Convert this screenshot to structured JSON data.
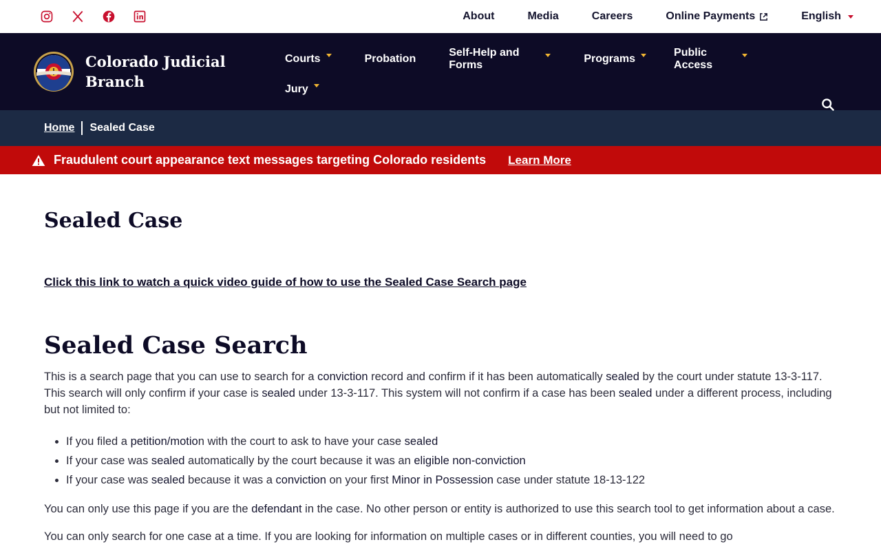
{
  "social": [
    {
      "name": "instagram-icon"
    },
    {
      "name": "x-icon"
    },
    {
      "name": "facebook-icon"
    },
    {
      "name": "linkedin-icon"
    }
  ],
  "utility_nav": {
    "about": "About",
    "media": "Media",
    "careers": "Careers",
    "online_payments": "Online Payments",
    "language": "English"
  },
  "brand": {
    "name": "Colorado Judicial Branch",
    "seal_top_text": "COLORADO",
    "seal_bottom_text": "COURTS"
  },
  "main_nav": {
    "courts": "Courts",
    "probation": "Probation",
    "self_help": "Self-Help and Forms",
    "programs": "Programs",
    "public_access": "Public Access",
    "jury": "Jury"
  },
  "breadcrumb": {
    "home": "Home",
    "current": "Sealed Case"
  },
  "alert": {
    "message": "Fraudulent court appearance text messages targeting Colorado residents",
    "link": "Learn More"
  },
  "content": {
    "title": "Sealed Case",
    "video_link": "Click this link to watch a quick video guide of how to use the Sealed Case Search page",
    "section_title": "Sealed Case Search",
    "p1": {
      "a": "This is a search page that you can use to search for a ",
      "b": "conviction",
      "c": " record and confirm if it has been automatically ",
      "d": "sealed",
      "e": " by the court under statute 13-3-117. This search will only confirm if your case is ",
      "f": "sealed",
      "g": " under 13-3-117. This system will not confirm if a case has been ",
      "h": "sealed",
      "i": " under a different process, including but not limited to:"
    },
    "bullets": [
      {
        "a": "If you filed a ",
        "b": "petition/motio",
        "c": "n with the court to ask to have your case ",
        "d": "sealed",
        "e": ""
      },
      {
        "a": "If your case was ",
        "b": "sealed",
        "c": " automatically by the court because it was an ",
        "d": "eligible non-conviction",
        "e": ""
      },
      {
        "a": "If your case was ",
        "b": "sealed",
        "c": " because it was a ",
        "d": "conviction",
        "e": " on your first ",
        "f": "Minor in Possession",
        "g": " case under statute 18-13-122"
      }
    ],
    "p2": {
      "a": "You can only use this page if you are the ",
      "b": "defendant",
      "c": " in the case. No other person or entity is authorized to use this search tool to get information about a case."
    },
    "p3": "You can only search for one case at a time. If you are looking for information on multiple cases or in different counties, you will need to go"
  }
}
